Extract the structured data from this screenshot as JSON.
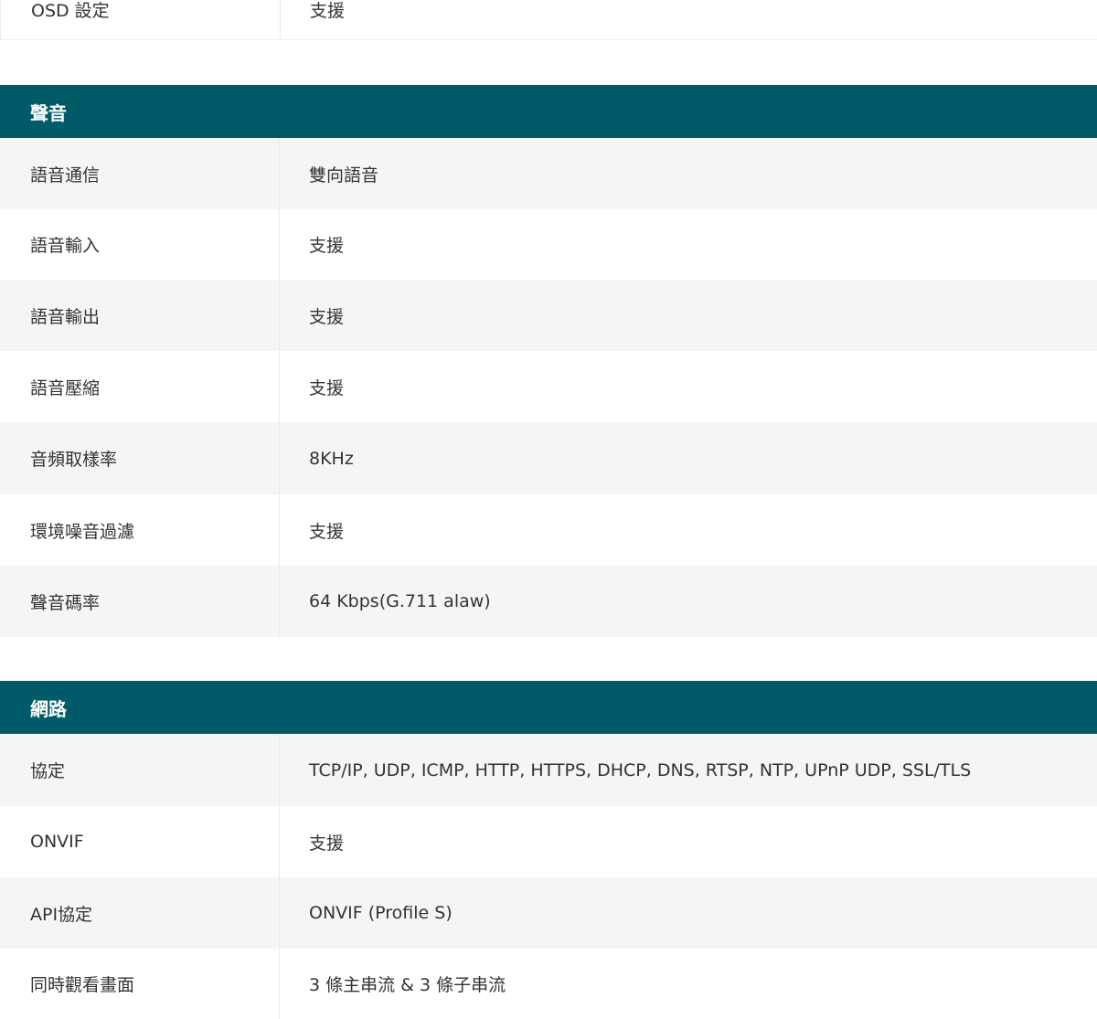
{
  "top_row": {
    "label": "OSD 設定",
    "value": "支援"
  },
  "sections": [
    {
      "title": "聲音",
      "rows": [
        {
          "label": "語音通信",
          "value": "雙向語音"
        },
        {
          "label": "語音輸入",
          "value": "支援"
        },
        {
          "label": "語音輸出",
          "value": "支援"
        },
        {
          "label": "語音壓縮",
          "value": "支援"
        },
        {
          "label": "音頻取樣率",
          "value": "8KHz"
        },
        {
          "label": "環境噪音過濾",
          "value": "支援"
        },
        {
          "label": "聲音碼率",
          "value": "64 Kbps(G.711 alaw)"
        }
      ]
    },
    {
      "title": "網路",
      "rows": [
        {
          "label": "協定",
          "value": "TCP/IP, UDP, ICMP, HTTP, HTTPS, DHCP, DNS, RTSP, NTP, UPnP UDP, SSL/TLS"
        },
        {
          "label": "ONVIF",
          "value": "支援"
        },
        {
          "label": "API協定",
          "value": "ONVIF (Profile S)"
        },
        {
          "label": "同時觀看畫面",
          "value": "3 條主串流 & 3 條子串流"
        }
      ]
    }
  ],
  "colors": {
    "header_bg": "#005a68",
    "row_shaded": "#f5f5f7",
    "text": "#333333"
  }
}
